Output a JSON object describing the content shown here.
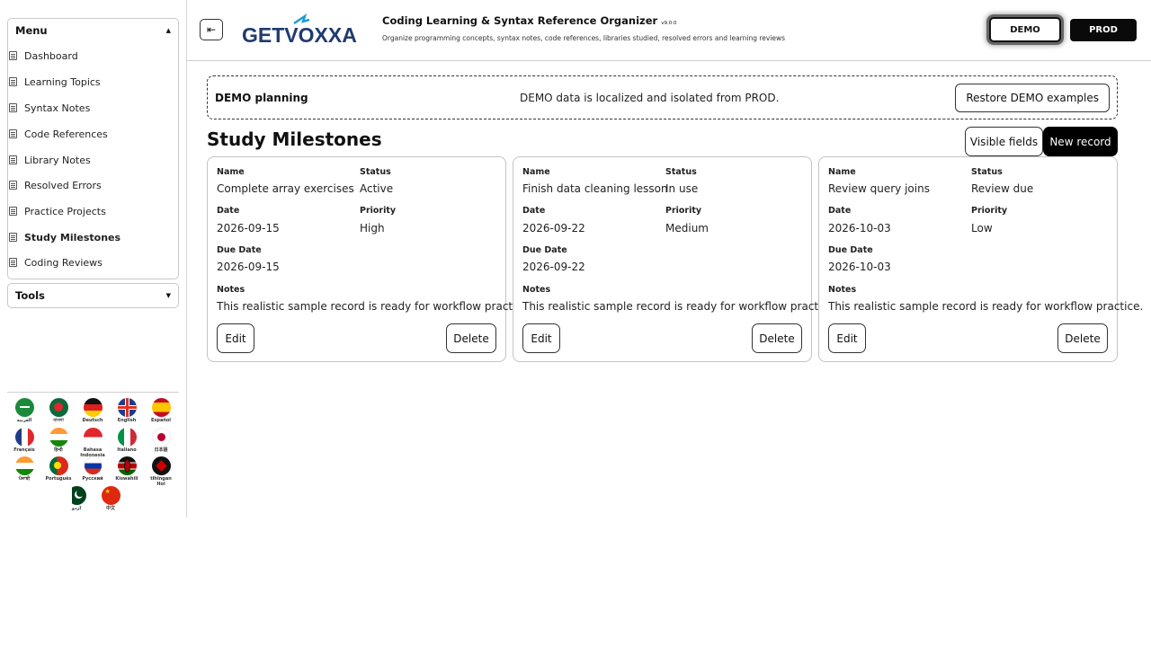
{
  "sidebar": {
    "menu_title": "Menu",
    "tools_title": "Tools",
    "items": [
      {
        "label": "Dashboard"
      },
      {
        "label": "Learning Topics"
      },
      {
        "label": "Syntax Notes"
      },
      {
        "label": "Code References"
      },
      {
        "label": "Library Notes"
      },
      {
        "label": "Resolved Errors"
      },
      {
        "label": "Practice Projects"
      },
      {
        "label": "Study Milestones",
        "active": true
      },
      {
        "label": "Coding Reviews"
      }
    ],
    "languages": [
      {
        "label": "العربية"
      },
      {
        "label": "বাংলা"
      },
      {
        "label": "Deutsch"
      },
      {
        "label": "English"
      },
      {
        "label": "Español"
      },
      {
        "label": "Français"
      },
      {
        "label": "हिन्दी"
      },
      {
        "label": "Bahasa Indonesia"
      },
      {
        "label": "Italiano"
      },
      {
        "label": "日本語"
      },
      {
        "label": "ਪੰਜਾਬੀ"
      },
      {
        "label": "Português"
      },
      {
        "label": "Русский"
      },
      {
        "label": "Kiswahili"
      },
      {
        "label": "tlhIngan Hol"
      },
      {
        "label": "اردو"
      },
      {
        "label": "中文"
      }
    ]
  },
  "header": {
    "logo_text": "GETVOXXA",
    "title": "Coding Learning & Syntax Reference Organizer",
    "version": "v9.0.0",
    "subtitle": "Organize programming concepts, syntax notes, code references, libraries studied, resolved errors and learning reviews",
    "env_demo": "DEMO",
    "env_prod": "PROD"
  },
  "banner": {
    "title": "DEMO planning",
    "message": "DEMO data is localized and isolated from PROD.",
    "restore_label": "Restore DEMO examples"
  },
  "section": {
    "title": "Study Milestones",
    "visible_fields_label": "Visible fields",
    "new_record_label": "New record"
  },
  "labels": {
    "name": "Name",
    "status": "Status",
    "date": "Date",
    "priority": "Priority",
    "due_date": "Due Date",
    "notes": "Notes",
    "edit": "Edit",
    "delete": "Delete"
  },
  "records": [
    {
      "name": "Complete array exercises",
      "status": "Active",
      "date": "2026-09-15",
      "priority": "High",
      "due_date": "2026-09-15",
      "notes": "This realistic sample record is ready for workflow practice."
    },
    {
      "name": "Finish data cleaning lesson",
      "status": "In use",
      "date": "2026-09-22",
      "priority": "Medium",
      "due_date": "2026-09-22",
      "notes": "This realistic sample record is ready for workflow practice."
    },
    {
      "name": "Review query joins",
      "status": "Review due",
      "date": "2026-10-03",
      "priority": "Low",
      "due_date": "2026-10-03",
      "notes": "This realistic sample record is ready for workflow practice."
    }
  ],
  "colors": {
    "accent": "#000000",
    "logo": "#1f3b70",
    "border": "#c4c4c4"
  }
}
